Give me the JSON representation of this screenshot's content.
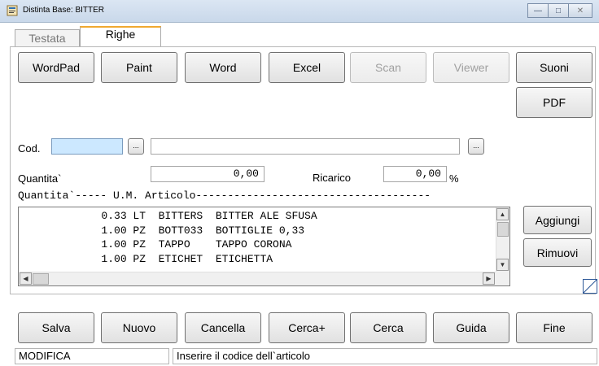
{
  "window": {
    "title": "Distinta Base: BITTER"
  },
  "tabs": [
    {
      "label": "Testata"
    },
    {
      "label": "Righe"
    }
  ],
  "top_buttons": {
    "wordpad": "WordPad",
    "paint": "Paint",
    "word": "Word",
    "excel": "Excel",
    "scan": "Scan",
    "viewer": "Viewer",
    "suoni": "Suoni",
    "pdf": "PDF"
  },
  "form": {
    "cod_label": "Cod.",
    "cod_value": "",
    "description_value": "",
    "ellipsis": "...",
    "quantita_label": "Quantita`",
    "quantita_value": "0,00",
    "ricarico_label": "Ricarico",
    "ricarico_value": "0,00",
    "percent": "%"
  },
  "list": {
    "header": "Quantita`----- U.M. Articolo-------------------------------------",
    "rows": [
      {
        "qty": "0.33",
        "um": "LT",
        "code": "BITTERS",
        "desc": "BITTER ALE SFUSA"
      },
      {
        "qty": "1.00",
        "um": "PZ",
        "code": "BOTT033",
        "desc": "BOTTIGLIE 0,33"
      },
      {
        "qty": "1.00",
        "um": "PZ",
        "code": "TAPPO",
        "desc": "TAPPO CORONA"
      },
      {
        "qty": "1.00",
        "um": "PZ",
        "code": "ETICHET",
        "desc": "ETICHETTA"
      }
    ]
  },
  "side_buttons": {
    "aggiungi": "Aggiungi",
    "rimuovi": "Rimuovi"
  },
  "bottom_buttons": {
    "salva": "Salva",
    "nuovo": "Nuovo",
    "cancella": "Cancella",
    "cerca_plus": "Cerca+",
    "cerca": "Cerca",
    "guida": "Guida",
    "fine": "Fine"
  },
  "status": {
    "mode": "MODIFICA",
    "hint": "Inserire il codice dell`articolo"
  },
  "colors": {
    "cod_field_bg": "#cce8ff",
    "active_tab_accent": "#f0a830"
  }
}
